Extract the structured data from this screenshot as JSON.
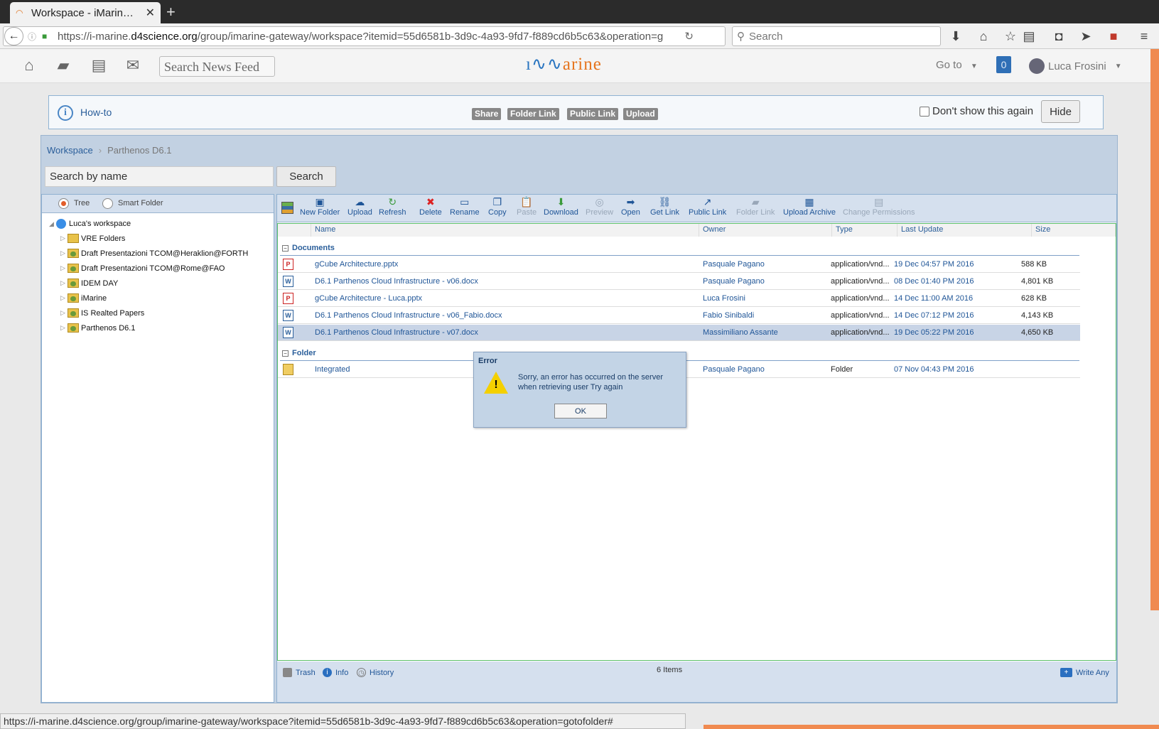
{
  "browser": {
    "tab_title": "Workspace - iMarin…",
    "url_prefix": "https://i-marine.",
    "url_host": "d4science.org",
    "url_rest": "/group/imarine-gateway/workspace?itemid=55d6581b-3d9c-4a93-9fd7-f889cd6b5c63&operation=g",
    "search_placeholder": "Search",
    "status_url": "https://i-marine.d4science.org/group/imarine-gateway/workspace?itemid=55d6581b-3d9c-4a93-9fd7-f889cd6b5c63&operation=gotofolder#"
  },
  "portal": {
    "newsfeed_placeholder": "Search News Feed",
    "logo_text": "arine",
    "goto_label": "Go to",
    "notif_count": "0",
    "user_name": "Luca Frosini"
  },
  "howto": {
    "label": "How-to",
    "tags": [
      "Share",
      "Folder Link",
      "Public Link",
      "Upload"
    ],
    "dont_show": "Don't show this again",
    "hide": "Hide"
  },
  "workspace": {
    "breadcrumb": [
      "Workspace",
      "Parthenos D6.1"
    ],
    "search_placeholder": "Search by name",
    "search_button": "Search",
    "view_modes": [
      "Tree",
      "Smart Folder"
    ],
    "tree_root": "Luca's workspace",
    "tree_items": [
      "VRE Folders",
      "Draft Presentazioni TCOM@Heraklion@FORTH",
      "Draft Presentazioni TCOM@Rome@FAO",
      "IDEM DAY",
      "iMarine",
      "IS Realted Papers",
      "Parthenos D6.1"
    ],
    "toolbar": [
      "New Folder",
      "Upload",
      "Refresh",
      "Delete",
      "Rename",
      "Copy",
      "Paste",
      "Download",
      "Preview",
      "Open",
      "Get Link",
      "Public Link",
      "Folder Link",
      "Upload Archive",
      "Change Permissions"
    ],
    "columns": [
      "Name",
      "Owner",
      "Type",
      "Last Update",
      "Size"
    ],
    "groups": {
      "documents": "Documents",
      "folder": "Folder"
    },
    "documents": [
      {
        "name": "gCube Architecture.pptx",
        "owner": "Pasquale Pagano",
        "type": "application/vnd...",
        "updated": "19 Dec 04:57 PM 2016",
        "size": "588 KB",
        "kind": "pptx"
      },
      {
        "name": "D6.1 Parthenos Cloud Infrastructure - v06.docx",
        "owner": "Pasquale Pagano",
        "type": "application/vnd...",
        "updated": "08 Dec 01:40 PM 2016",
        "size": "4,801 KB",
        "kind": "docx"
      },
      {
        "name": "gCube Architecture - Luca.pptx",
        "owner": "Luca Frosini",
        "type": "application/vnd...",
        "updated": "14 Dec 11:00 AM 2016",
        "size": "628 KB",
        "kind": "pptx"
      },
      {
        "name": "D6.1 Parthenos Cloud Infrastructure - v06_Fabio.docx",
        "owner": "Fabio Sinibaldi",
        "type": "application/vnd...",
        "updated": "14 Dec 07:12 PM 2016",
        "size": "4,143 KB",
        "kind": "docx"
      },
      {
        "name": "D6.1 Parthenos Cloud Infrastructure - v07.docx",
        "owner": "Massimiliano Assante",
        "type": "application/vnd...",
        "updated": "19 Dec 05:22 PM 2016",
        "size": "4,650 KB",
        "kind": "docx"
      }
    ],
    "folders": [
      {
        "name": "Integrated",
        "owner": "Pasquale Pagano",
        "type": "Folder",
        "updated": "07 Nov 04:43 PM 2016",
        "size": ""
      }
    ],
    "status": {
      "trash": "Trash",
      "info": "Info",
      "history": "History",
      "count": "6 Items",
      "write": "Write Any"
    }
  },
  "dialog": {
    "title": "Error",
    "message": "Sorry, an error has occurred on the server when retrieving user Try again",
    "ok": "OK"
  }
}
